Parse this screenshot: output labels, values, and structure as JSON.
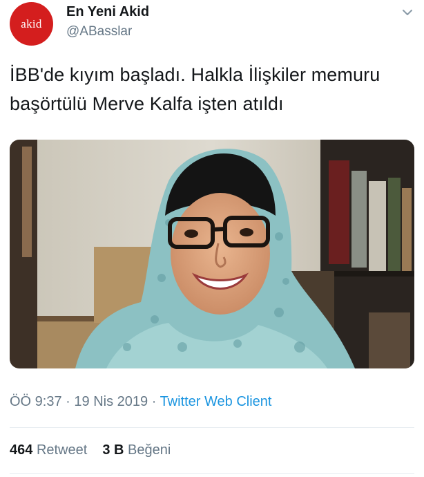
{
  "author": {
    "avatar_text": "akid",
    "display_name": "En Yeni Akid",
    "handle": "@ABasslar"
  },
  "tweet": {
    "text_line1": "İBB'de kıyım başladı. Halkla İlişkiler memuru",
    "text_line2": "başörtülü Merve Kalfa işten atıldı"
  },
  "meta": {
    "time": "ÖÖ 9:37",
    "separator": " · ",
    "date": "19 Nis 2019",
    "client": "Twitter Web Client"
  },
  "stats": {
    "retweets_count": "464",
    "retweets_label": "Retweet",
    "likes_count": "3 B",
    "likes_label": "Beğeni"
  },
  "colors": {
    "avatar_bg": "#d41e1e",
    "link": "#1b95e0",
    "secondary_text": "#657786"
  },
  "icons": {
    "menu": "chevron-down-icon"
  }
}
